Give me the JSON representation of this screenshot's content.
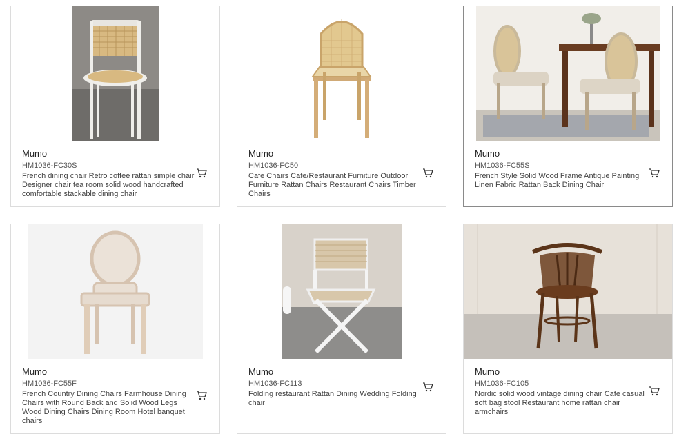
{
  "products": [
    {
      "brand": "Mumo",
      "sku": "HM1036-FC30S",
      "description": "French dining chair Retro coffee rattan simple chair Designer chair tea room solid wood handcrafted comfortable stackable dining chair",
      "image_icon": "rattan-chair-white-frame"
    },
    {
      "brand": "Mumo",
      "sku": "HM1036-FC50",
      "description": "Cafe Chairs Cafe/Restaurant Furniture Outdoor Furniture Rattan Chairs Restaurant Chairs Timber Chairs",
      "image_icon": "rattan-chair-natural-wood"
    },
    {
      "brand": "Mumo",
      "sku": "HM1036-FC55S",
      "description": "French Style Solid Wood Frame Antique Painting Linen Fabric Rattan Back Dining Chair",
      "image_icon": "rattan-back-dining-chairs-room"
    },
    {
      "brand": "Mumo",
      "sku": "HM1036-FC55F",
      "description": "French Country Dining Chairs Farmhouse Dining Chairs with Round Back and Solid Wood Legs Wood Dining Chairs Dining Room Hotel banquet chairs",
      "image_icon": "upholstered-round-back-chair"
    },
    {
      "brand": "Mumo",
      "sku": "HM1036-FC113",
      "description": "Folding restaurant Rattan Dining Wedding Folding chair",
      "image_icon": "folding-rope-chair"
    },
    {
      "brand": "Mumo",
      "sku": "HM1036-FC105",
      "description": "Nordic solid wood vintage dining chair Cafe casual soft bag stool Restaurant home rattan chair armchairs",
      "image_icon": "bentwood-armchair"
    }
  ],
  "colors": {
    "card_border": "#dcdcdc",
    "card_border_active": "#8a8a8a",
    "text_primary": "#222222",
    "text_secondary": "#555555"
  }
}
